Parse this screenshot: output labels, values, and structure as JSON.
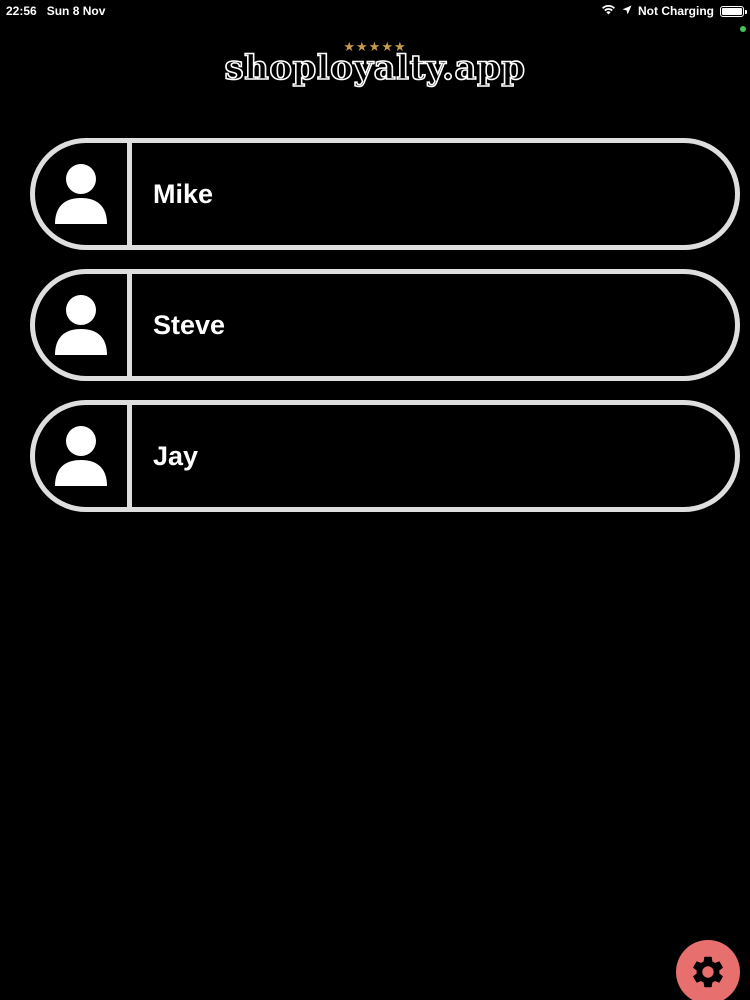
{
  "status_bar": {
    "time": "22:56",
    "date": "Sun 8 Nov",
    "charging": "Not Charging"
  },
  "logo": {
    "stars": "★★★★★",
    "text": "shoployalty.app"
  },
  "users": [
    {
      "name": "Mike"
    },
    {
      "name": "Steve"
    },
    {
      "name": "Jay"
    }
  ],
  "colors": {
    "background": "#000000",
    "card_border": "#dedede",
    "stars": "#c79a4e",
    "settings_button": "#e7706e",
    "indicator_dot": "#3fc55a"
  },
  "icons": {
    "avatar": "person-icon",
    "settings": "gear-icon",
    "wifi": "wifi-icon",
    "location": "location-arrow-icon",
    "battery": "battery-icon"
  }
}
